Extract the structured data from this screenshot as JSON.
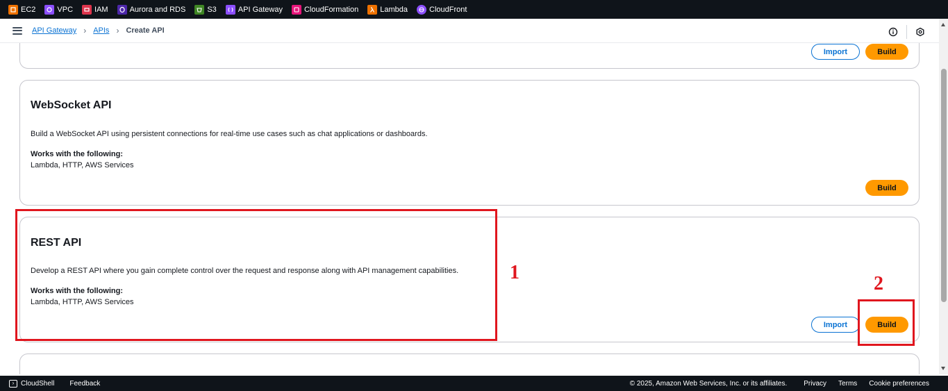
{
  "services": [
    {
      "label": "EC2",
      "color": "#ed7100",
      "icon": "ec2-icon"
    },
    {
      "label": "VPC",
      "color": "#8c4fff",
      "icon": "vpc-icon"
    },
    {
      "label": "IAM",
      "color": "#dd344c",
      "icon": "iam-icon"
    },
    {
      "label": "Aurora and RDS",
      "color": "#4d27aa",
      "icon": "rds-icon"
    },
    {
      "label": "S3",
      "color": "#3f8624",
      "icon": "s3-icon"
    },
    {
      "label": "API Gateway",
      "color": "#8c4fff",
      "icon": "api-gateway-icon"
    },
    {
      "label": "CloudFormation",
      "color": "#e7157b",
      "icon": "cloudformation-icon"
    },
    {
      "label": "Lambda",
      "color": "#ed7100",
      "icon": "lambda-icon"
    },
    {
      "label": "CloudFront",
      "color": "#8c4fff",
      "icon": "cloudfront-icon"
    }
  ],
  "breadcrumb": {
    "items": [
      "API Gateway",
      "APIs"
    ],
    "current": "Create API"
  },
  "cards": {
    "top_partial": {
      "import_label": "Import",
      "build_label": "Build"
    },
    "websocket": {
      "title": "WebSocket API",
      "description": "Build a WebSocket API using persistent connections for real-time use cases such as chat applications or dashboards.",
      "works_heading": "Works with the following:",
      "works_value": "Lambda, HTTP, AWS Services",
      "build_label": "Build"
    },
    "rest": {
      "title": "REST API",
      "description": "Develop a REST API where you gain complete control over the request and response along with API management capabilities.",
      "works_heading": "Works with the following:",
      "works_value": "Lambda, HTTP, AWS Services",
      "import_label": "Import",
      "build_label": "Build"
    }
  },
  "annotations": {
    "one": "1",
    "two": "2",
    "color": "#e0161e"
  },
  "footer": {
    "cloudshell": "CloudShell",
    "feedback": "Feedback",
    "copyright": "© 2025, Amazon Web Services, Inc. or its affiliates.",
    "privacy": "Privacy",
    "terms": "Terms",
    "cookies": "Cookie preferences"
  },
  "colors": {
    "build_button": "#ff9900",
    "link": "#0972d3",
    "nav_dark": "#0f141a"
  }
}
